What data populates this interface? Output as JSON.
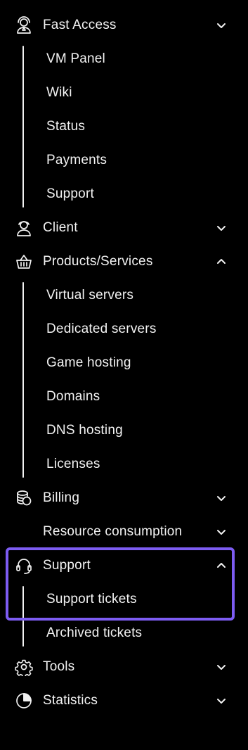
{
  "menu": {
    "fast_access": {
      "label": "Fast Access",
      "icon": "user-headset-icon",
      "expanded": true,
      "items": [
        "VM Panel",
        "Wiki",
        "Status",
        "Payments",
        "Support"
      ]
    },
    "client": {
      "label": "Client",
      "icon": "user-icon",
      "expanded": false
    },
    "products": {
      "label": "Products/Services",
      "icon": "basket-icon",
      "expanded": true,
      "items": [
        "Virtual servers",
        "Dedicated servers",
        "Game hosting",
        "Domains",
        "DNS hosting",
        "Licenses"
      ]
    },
    "billing": {
      "label": "Billing",
      "icon": "coins-icon",
      "expanded": false
    },
    "resource_consumption": {
      "label": "Resource consumption",
      "expanded": false
    },
    "support": {
      "label": "Support",
      "icon": "headset-icon",
      "expanded": true,
      "items": [
        "Support tickets",
        "Archived tickets"
      ]
    },
    "tools": {
      "label": "Tools",
      "icon": "gear-icon",
      "expanded": false
    },
    "statistics": {
      "label": "Statistics",
      "icon": "pie-chart-icon",
      "expanded": false
    }
  },
  "colors": {
    "background": "#000000",
    "text": "#f2f2f2",
    "highlight": "#7d5cf2"
  }
}
